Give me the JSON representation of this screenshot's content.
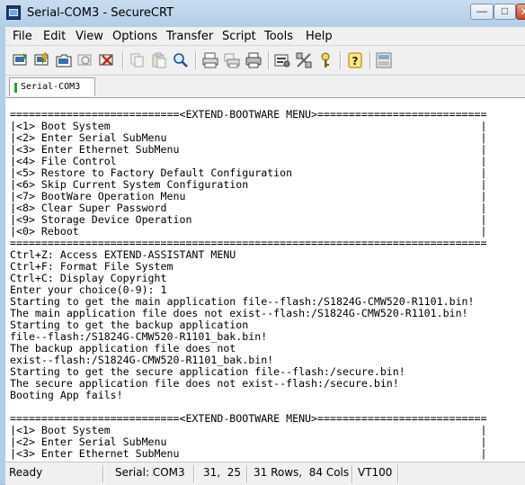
{
  "window": {
    "title": "Serial-COM3 - SecureCRT",
    "controls": {
      "minimize": "—",
      "maximize": "□",
      "close": "x"
    }
  },
  "menubar": {
    "items": [
      "File",
      "Edit",
      "View",
      "Options",
      "Transfer",
      "Script",
      "Tools",
      "Help"
    ]
  },
  "toolbar": {
    "icons": [
      "connect-icon",
      "quick-connect-icon",
      "connect-in-tab-icon",
      "reconnect-icon",
      "disconnect-icon",
      "copy-icon",
      "paste-icon",
      "find-icon",
      "print-setup-icon",
      "print-selection-icon",
      "print-icon",
      "session-options-icon",
      "global-options-icon",
      "keymap-icon",
      "help-icon",
      "sftp-icon"
    ]
  },
  "tabs": [
    {
      "label": "Serial-COM3",
      "status_color": "#26a326"
    }
  ],
  "terminal": {
    "lines": [
      "===========================<EXTEND-BOOTWARE MENU>===========================",
      "|<1> Boot System                                                           |",
      "|<2> Enter Serial SubMenu                                                  |",
      "|<3> Enter Ethernet SubMenu                                                |",
      "|<4> File Control                                                          |",
      "|<5> Restore to Factory Default Configuration                              |",
      "|<6> Skip Current System Configuration                                     |",
      "|<7> BootWare Operation Menu                                               |",
      "|<8> Clear Super Password                                                  |",
      "|<9> Storage Device Operation                                              |",
      "|<0> Reboot                                                                |",
      "============================================================================",
      "Ctrl+Z: Access EXTEND-ASSISTANT MENU",
      "Ctrl+F: Format File System",
      "Ctrl+C: Display Copyright",
      "Enter your choice(0-9): 1",
      "Starting to get the main application file--flash:/S1824G-CMW520-R1101.bin!",
      "The main application file does not exist--flash:/S1824G-CMW520-R1101.bin!",
      "Starting to get the backup application",
      "file--flash:/S1824G-CMW520-R1101_bak.bin!",
      "The backup application file does not",
      "exist--flash:/S1824G-CMW520-R1101_bak.bin!",
      "Starting to get the secure application file--flash:/secure.bin!",
      "The secure application file does not exist--flash:/secure.bin!",
      "Booting App fails!",
      "",
      "===========================<EXTEND-BOOTWARE MENU>===========================",
      "|<1> Boot System                                                           |",
      "|<2> Enter Serial SubMenu                                                  |",
      "|<3> Enter Ethernet SubMenu                                                |"
    ]
  },
  "statusbar": {
    "ready": "Ready",
    "connection": "Serial: COM3",
    "cursor": "31,  25",
    "size": "31 Rows,  84 Cols",
    "emulation": "VT100"
  }
}
